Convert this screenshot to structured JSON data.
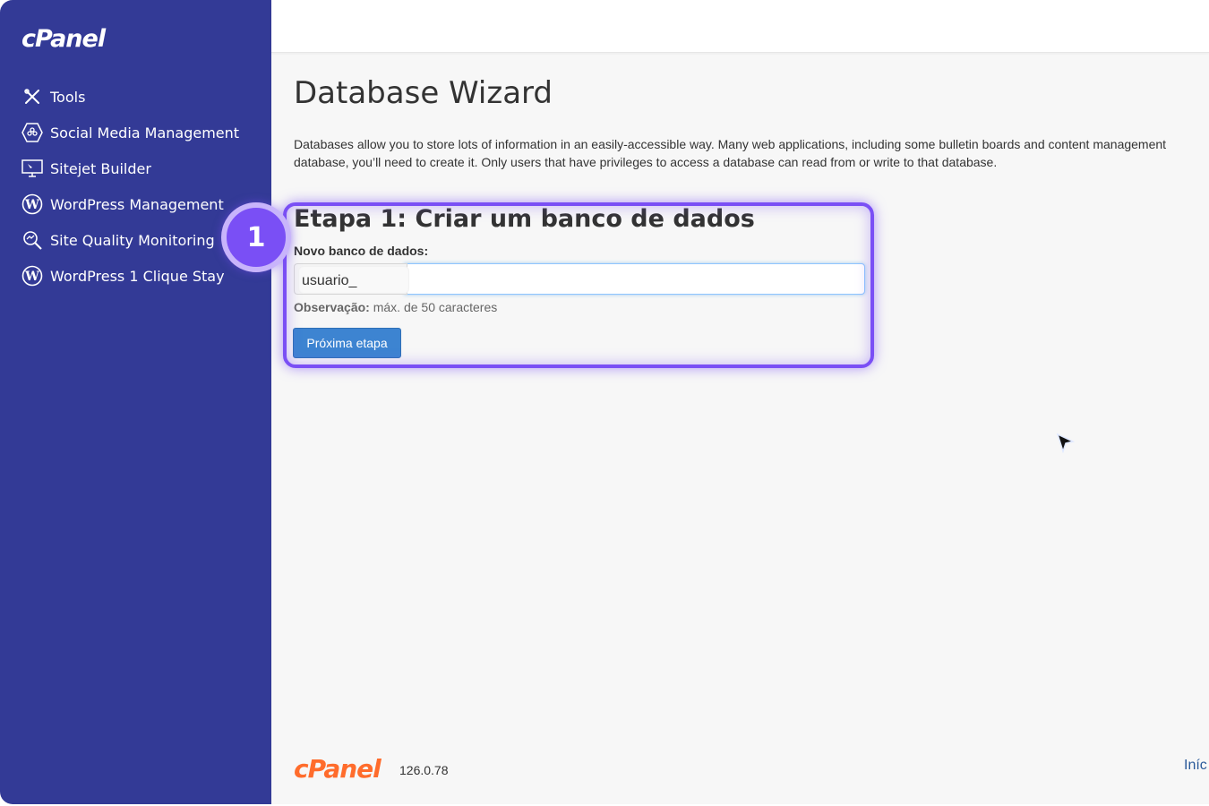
{
  "sidebar": {
    "logo": "cPanel",
    "items": [
      {
        "label": "Tools",
        "icon": "tools-icon"
      },
      {
        "label": "Social Media Management",
        "icon": "social-media-icon"
      },
      {
        "label": "Sitejet Builder",
        "icon": "sitejet-icon"
      },
      {
        "label": "WordPress Management",
        "icon": "wordpress-icon"
      },
      {
        "label": "Site Quality Monitoring",
        "icon": "site-quality-icon"
      },
      {
        "label": "WordPress 1 Clique Stay",
        "icon": "wordpress-icon"
      }
    ]
  },
  "main": {
    "title": "Database Wizard",
    "description_line1": "Databases allow you to store lots of information in an easily-accessible way. Many web applications, including some bulletin boards and content management",
    "description_line2": "database, you’ll need to create it. Only users that have privileges to access a database can read from or write to that database.",
    "step_title": "Etapa 1: Criar um banco de dados",
    "field_label": "Novo banco de dados:",
    "prefix": "usuario_",
    "input_value": "",
    "note_label": "Observação:",
    "note_text": " máx. de 50 caracteres",
    "next_button": "Próxima etapa"
  },
  "overlay": {
    "step_number": "1",
    "accent_color": "#7a4ff5"
  },
  "footer": {
    "logo": "cPanel",
    "version": "126.0.78",
    "link": "Iníc"
  },
  "colors": {
    "sidebar": "#333a96",
    "footer_logo": "#ff6c2c",
    "button": "#3d84d1"
  }
}
